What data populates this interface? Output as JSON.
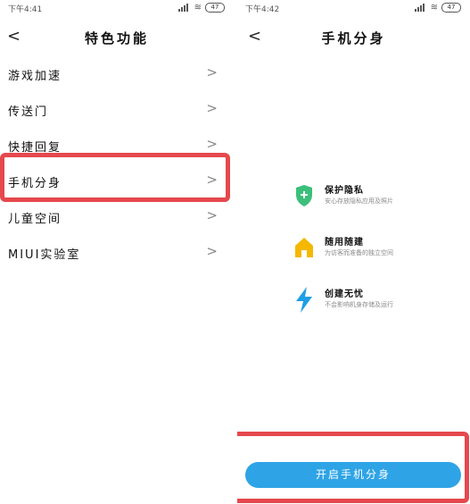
{
  "left": {
    "status": {
      "time": "下午4:41",
      "battery": "47"
    },
    "nav": {
      "back": "<",
      "title": "特色功能"
    },
    "items": [
      {
        "label": "游戏加速"
      },
      {
        "label": "传送门"
      },
      {
        "label": "快捷回复"
      },
      {
        "label": "手机分身"
      },
      {
        "label": "儿童空间"
      },
      {
        "label": "MIUI实验室"
      }
    ],
    "chevron": ">"
  },
  "right": {
    "status": {
      "time": "下午4:42",
      "battery": "47"
    },
    "nav": {
      "back": "<",
      "title": "手机分身"
    },
    "features": [
      {
        "icon": "shield-plus-icon",
        "title": "保护隐私",
        "desc": "安心存放隐私应用及照片"
      },
      {
        "icon": "house-icon",
        "title": "随用随建",
        "desc": "为访客而准备的独立空间"
      },
      {
        "icon": "lightning-icon",
        "title": "创建无忧",
        "desc": "不会影响机身存储及运行"
      }
    ],
    "button": {
      "label": "开启手机分身"
    }
  },
  "colors": {
    "accent": "#2ea4e6",
    "highlight": "#e5484d",
    "shield": "#3bbf7a",
    "house": "#f5b800",
    "bolt": "#1e9ee6"
  }
}
